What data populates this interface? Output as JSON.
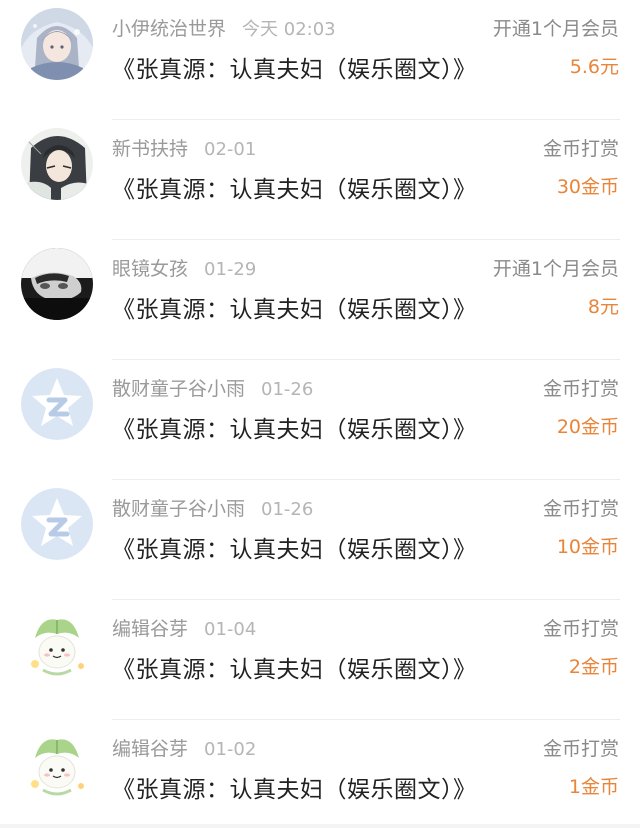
{
  "records": [
    {
      "user": "小伊统治世界",
      "date": "今天 02:03",
      "title": "《张真源：认真夫妇（娱乐圈文）》",
      "type": "开通1个月会员",
      "amount": "5.6元",
      "avatar": "avatar-anime-girl",
      "truncate": true
    },
    {
      "user": "新书扶持",
      "date": "02-01",
      "title": "《张真源：认真夫妇（娱乐圈文）》",
      "type": "金币打赏",
      "amount": "30金币",
      "avatar": "avatar-anime-boy",
      "truncate": false
    },
    {
      "user": "眼镜女孩",
      "date": "01-29",
      "title": "《张真源：认真夫妇（娱乐圈文）》",
      "type": "开通1个月会员",
      "amount": "8元",
      "avatar": "avatar-photo-bw",
      "truncate": true
    },
    {
      "user": "散财童子谷小雨",
      "date": "01-26",
      "title": "《张真源：认真夫妇（娱乐圈文）》",
      "type": "金币打赏",
      "amount": "20金币",
      "avatar": "avatar-default-star",
      "truncate": false
    },
    {
      "user": "散财童子谷小雨",
      "date": "01-26",
      "title": "《张真源：认真夫妇（娱乐圈文）》",
      "type": "金币打赏",
      "amount": "10金币",
      "avatar": "avatar-default-star",
      "truncate": false
    },
    {
      "user": "编辑谷芽",
      "date": "01-04",
      "title": "《张真源：认真夫妇（娱乐圈文）》",
      "type": "金币打赏",
      "amount": "2金币",
      "avatar": "avatar-sprout-mascot",
      "truncate": false
    },
    {
      "user": "编辑谷芽",
      "date": "01-02",
      "title": "《张真源：认真夫妇（娱乐圈文）》",
      "type": "金币打赏",
      "amount": "1金币",
      "avatar": "avatar-sprout-mascot",
      "truncate": false
    }
  ],
  "colors": {
    "amount": "#e8853a",
    "username": "#9a9a9a",
    "title": "#222222"
  }
}
